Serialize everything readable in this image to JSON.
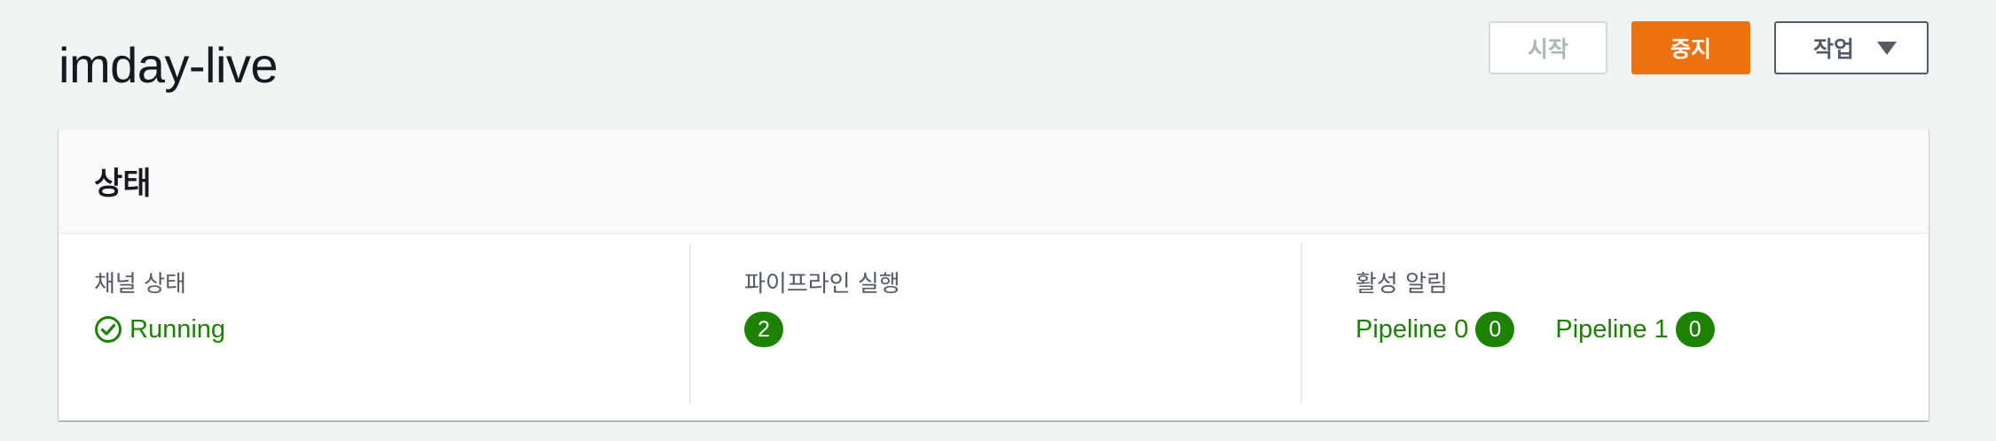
{
  "page": {
    "title": "imday-live"
  },
  "actions": {
    "start_label": "시작",
    "stop_label": "중지",
    "actions_label": "작업"
  },
  "status_panel": {
    "title": "상태",
    "channel_state": {
      "label": "채널 상태",
      "value": "Running",
      "icon": "check-circle-icon"
    },
    "pipelines_running": {
      "label": "파이프라인 실행",
      "count": "2"
    },
    "active_alerts": {
      "label": "활성 알림",
      "pipelines": [
        {
          "name": "Pipeline 0",
          "count": "0"
        },
        {
          "name": "Pipeline 1",
          "count": "0"
        }
      ]
    }
  },
  "colors": {
    "background": "#f2f3f3",
    "accent_orange": "#ec7211",
    "success_green": "#1d8102",
    "text_primary": "#16191f",
    "text_secondary": "#545b64"
  }
}
